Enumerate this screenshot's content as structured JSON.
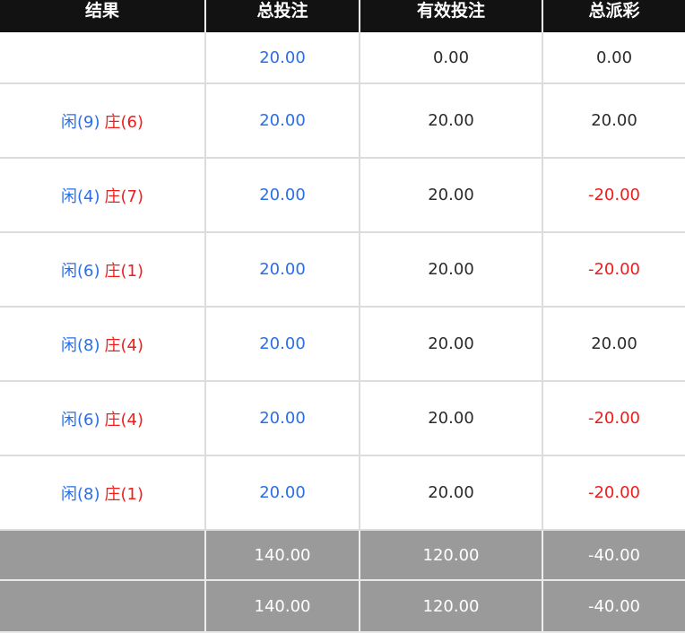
{
  "header": {
    "result": "结果",
    "total_bet": "总投注",
    "valid_bet": "有效投注",
    "total_payout": "总派彩"
  },
  "rows": [
    {
      "player_label": "",
      "player_score": "",
      "banker_label": "",
      "banker_score": "",
      "total_bet": "20.00",
      "valid_bet": "0.00",
      "payout": "0.00",
      "payout_negative": false
    },
    {
      "player_label": "闲",
      "player_score": "(9)",
      "banker_label": "庄",
      "banker_score": "(6)",
      "total_bet": "20.00",
      "valid_bet": "20.00",
      "payout": "20.00",
      "payout_negative": false
    },
    {
      "player_label": "闲",
      "player_score": "(4)",
      "banker_label": "庄",
      "banker_score": "(7)",
      "total_bet": "20.00",
      "valid_bet": "20.00",
      "payout": "-20.00",
      "payout_negative": true
    },
    {
      "player_label": "闲",
      "player_score": "(6)",
      "banker_label": "庄",
      "banker_score": "(1)",
      "total_bet": "20.00",
      "valid_bet": "20.00",
      "payout": "-20.00",
      "payout_negative": true
    },
    {
      "player_label": "闲",
      "player_score": "(8)",
      "banker_label": "庄",
      "banker_score": "(4)",
      "total_bet": "20.00",
      "valid_bet": "20.00",
      "payout": "20.00",
      "payout_negative": false
    },
    {
      "player_label": "闲",
      "player_score": "(6)",
      "banker_label": "庄",
      "banker_score": "(4)",
      "total_bet": "20.00",
      "valid_bet": "20.00",
      "payout": "-20.00",
      "payout_negative": true
    },
    {
      "player_label": "闲",
      "player_score": "(8)",
      "banker_label": "庄",
      "banker_score": "(1)",
      "total_bet": "20.00",
      "valid_bet": "20.00",
      "payout": "-20.00",
      "payout_negative": true
    }
  ],
  "totals": [
    {
      "label": "",
      "total_bet": "140.00",
      "valid_bet": "120.00",
      "payout": "-40.00"
    },
    {
      "label": "",
      "total_bet": "140.00",
      "valid_bet": "120.00",
      "payout": "-40.00"
    }
  ],
  "colors": {
    "header_bg": "#121212",
    "bet_blue": "#2a6ee8",
    "negative_red": "#ee1c1c",
    "total_row_bg": "#9a9a9a"
  }
}
